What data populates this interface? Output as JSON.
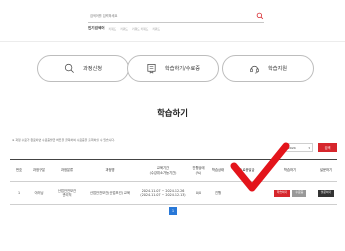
{
  "search": {
    "placeholder": "검색어를 입력하세요"
  },
  "popular": {
    "label": "인기검색어",
    "keywords": [
      "키워드",
      "키워드",
      "키워드 키워드",
      "키워드"
    ]
  },
  "quick": [
    {
      "label": "과정신청",
      "icon": "search-icon"
    },
    {
      "label": "학습하기/수료증",
      "icon": "certificate-icon"
    },
    {
      "label": "학습지원",
      "icon": "headset-icon"
    }
  ],
  "page_title": "학습하기",
  "notice": "※ 과정 수료가 완료되면 수료증발급 버튼을 클릭하여 수료증을 출력하실 수 있습니다.",
  "year": "2024",
  "search_button": "검색",
  "table": {
    "headers": [
      "번호",
      "과정구분",
      "과정분류",
      "과정명",
      "교육기간\n(수강취소가능기간)",
      "진행상태\n(%)",
      "학습상태",
      "수료증발급",
      "학습하기",
      "설문하기"
    ],
    "row": {
      "no": "1",
      "type": "이러닝",
      "category": "산업안전보건\n관리직",
      "course": "산업안전보건(산업보건) 교육",
      "period": "2024.11.07 ~ 2024.12.26\n(2024.11.07 ~ 2024.12.13)",
      "progress": "0/0",
      "status": "진행",
      "cert": "",
      "study_btn": "학습하기",
      "cert_btn": "수료증",
      "survey_btn": "설문하기"
    }
  },
  "pager": {
    "current": "1"
  },
  "colors": {
    "accent": "#d6262c",
    "pager": "#2878d8"
  }
}
